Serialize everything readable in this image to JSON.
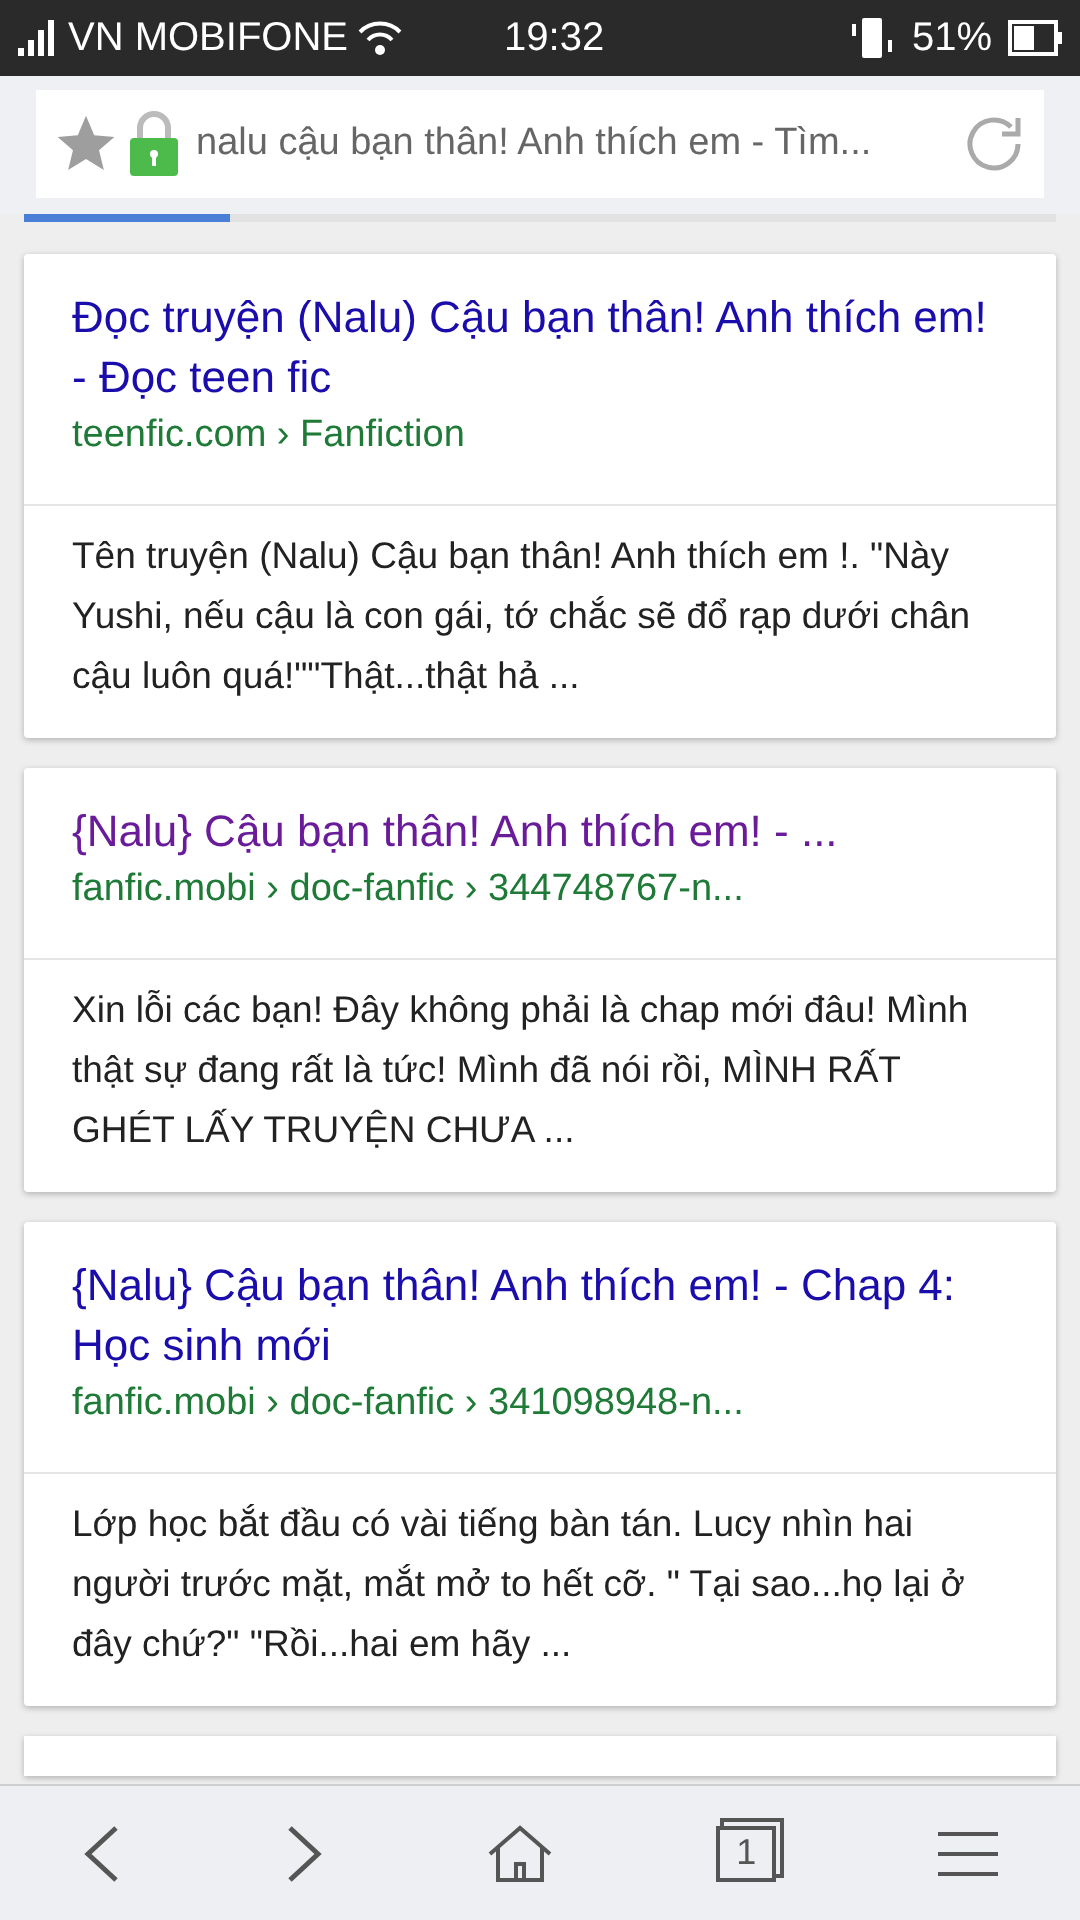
{
  "status_bar": {
    "carrier": "VN MOBIFONE",
    "time": "19:32",
    "battery": "51%"
  },
  "address_bar": {
    "bookmarked": false,
    "secure": true,
    "title": "nalu cậu bạn thân! Anh thích em - Tìm..."
  },
  "progress": {
    "level": 0.2
  },
  "results": [
    {
      "title": "Đọc truyện (Nalu) Cậu bạn thân! Anh thích em! - Đọc teen fic",
      "visited": false,
      "url": "teenfic.com › Fanfiction",
      "snippet": "Tên truyện (Nalu) Cậu bạn thân! Anh thích em !. \"Này Yushi, nếu cậu là con gái, tớ chắc sẽ đổ rạp dưới chân cậu luôn quá!\"\"Thật...thật hả  ..."
    },
    {
      "title": "{Nalu} Cậu bạn thân! Anh thích em! - ...",
      "visited": true,
      "url": "fanfic.mobi › doc-fanfic › 344748767-n...",
      "snippet": "Xin lỗi các bạn! Đây không phải là chap mới đâu! Mình thật sự đang rất là tức! Mình đã nói rồi, MÌNH RẤT GHÉT LẤY TRUYỆN CHƯA ..."
    },
    {
      "title": "{Nalu} Cậu bạn thân! Anh thích em! - Chap 4: Học sinh mới",
      "visited": false,
      "url": "fanfic.mobi › doc-fanfic › 341098948-n...",
      "snippet": "Lớp học bắt đầu có vài tiếng bàn tán. Lucy nhìn hai người trước mặt, mắt mở to hết cỡ. \" Tại sao...họ lại ở đây chứ?\" \"Rồi...hai em hãy  ..."
    }
  ],
  "toolbar": {
    "tab_count": "1"
  }
}
